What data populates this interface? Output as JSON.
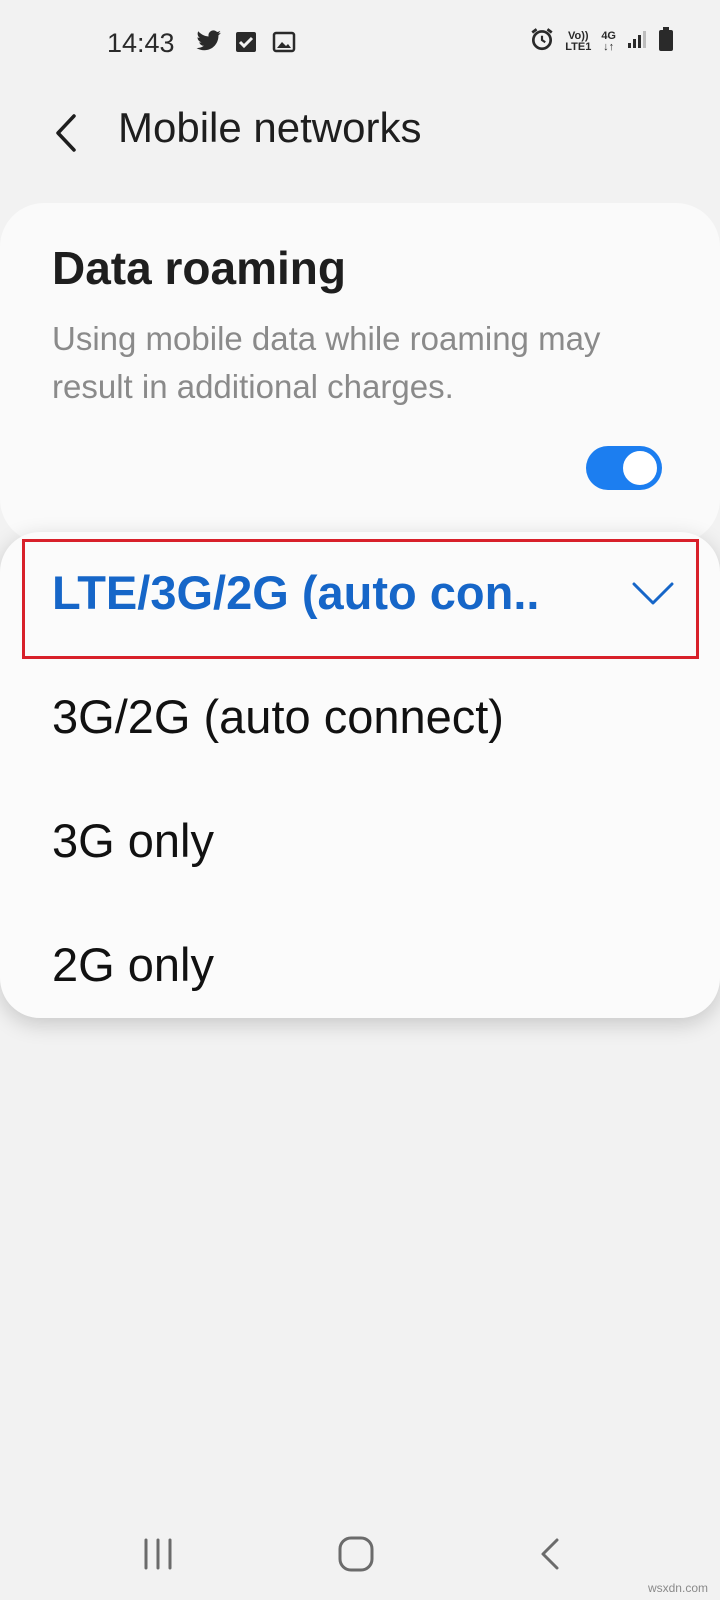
{
  "status_bar": {
    "time": "14:43",
    "left_icons": [
      "twitter-icon",
      "check-box-icon",
      "gallery-icon"
    ],
    "volte_top": "Vo))",
    "volte_bottom": "LTE1",
    "network_type": "4G",
    "right_icons": [
      "alarm-icon",
      "signal-icon",
      "battery-icon"
    ]
  },
  "header": {
    "title": "Mobile networks",
    "back_icon": "chevron-left-icon"
  },
  "data_roaming": {
    "title": "Data roaming",
    "description": "Using mobile data while roaming may result in additional charges.",
    "toggle_on": true,
    "accent_color": "#1c7ef0"
  },
  "network_mode_options": [
    {
      "label": "LTE/3G/2G (auto con..",
      "selected": true
    },
    {
      "label": "3G/2G (auto connect)",
      "selected": false
    },
    {
      "label": "3G only",
      "selected": false
    },
    {
      "label": "2G only",
      "selected": false
    }
  ],
  "colors": {
    "selected_text": "#1666c8",
    "highlight_border": "#d8202a"
  },
  "nav_bar": {
    "icons": [
      "recent-apps-icon",
      "home-icon",
      "back-icon"
    ]
  },
  "watermark": "wsxdn.com"
}
